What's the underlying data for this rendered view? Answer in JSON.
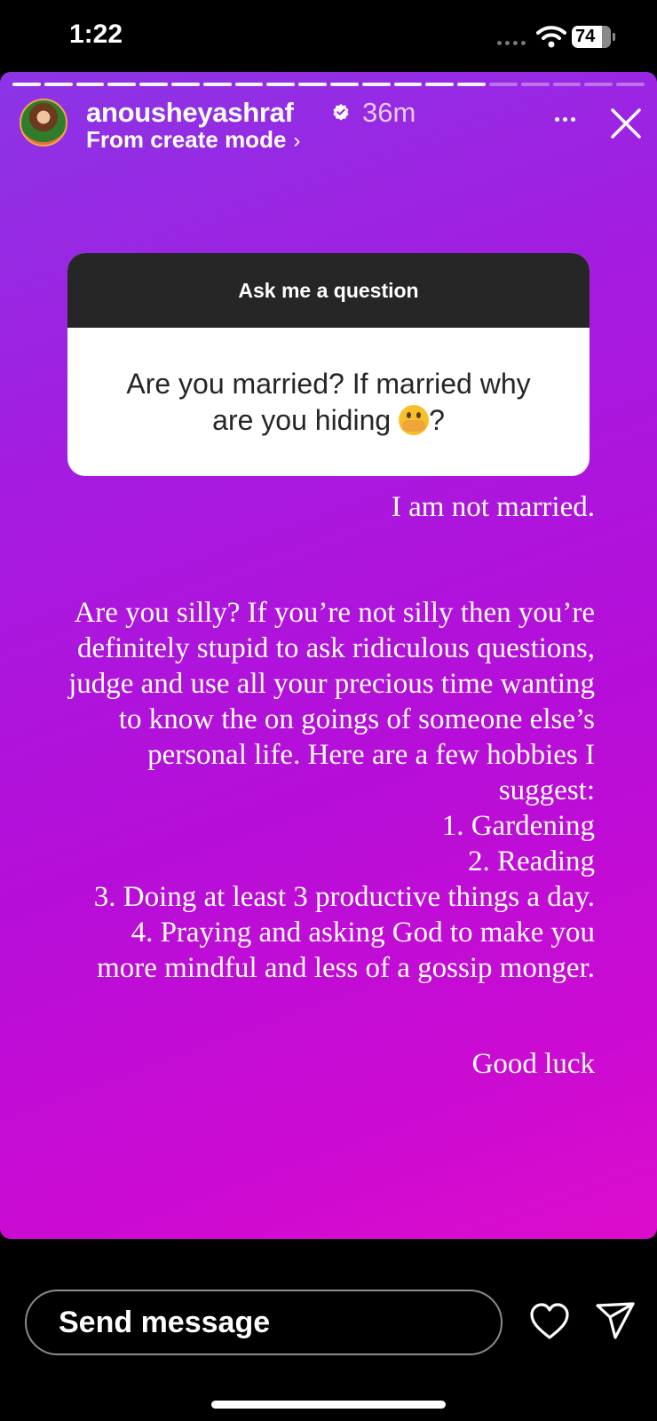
{
  "status_bar": {
    "time": "1:22",
    "battery_level": "74"
  },
  "story": {
    "progress": {
      "segments_total": 20,
      "segments_viewed": 15
    },
    "header": {
      "username": "anousheyashraf",
      "verified": true,
      "age": "36m",
      "subline": "From create mode",
      "subline_chevron": "›"
    },
    "sticker": {
      "prompt": "Ask me a question",
      "question": "Are you married? If married why are you hiding",
      "question_emoji": "face-with-hand-over-mouth-emoji",
      "question_suffix": "?"
    },
    "answer": {
      "first_line": "I am not married.",
      "paragraph": [
        "Are you silly? If you’re not silly then you’re",
        "definitely stupid to ask ridiculous questions,",
        "judge and use all your precious time wanting",
        "to know the on goings of someone else’s",
        "personal life. Here are a few hobbies I",
        "suggest:",
        "1. Gardening",
        "2. Reading",
        "3. Doing at least 3 productive things a day.",
        "4.  Praying and asking God to make you",
        "more mindful and less of a gossip monger."
      ],
      "closing": "Good luck"
    },
    "colors": {
      "gradient": [
        "#8b35e6",
        "#a51be0",
        "#b60ed8",
        "#cc0bd2",
        "#dc0ccb"
      ],
      "sticker_header": "#262626"
    }
  },
  "footer": {
    "reply_placeholder": "Send message",
    "like_icon": "heart-icon",
    "share_icon": "paper-plane-icon"
  }
}
